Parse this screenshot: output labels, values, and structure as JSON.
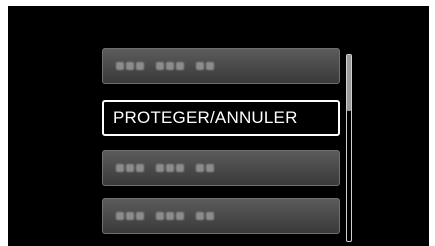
{
  "menu": {
    "items": [
      {
        "label": "",
        "blurred": true,
        "selected": false
      },
      {
        "label": "PROTEGER/ANNULER",
        "blurred": false,
        "selected": true
      },
      {
        "label": "",
        "blurred": true,
        "selected": false
      },
      {
        "label": "",
        "blurred": true,
        "selected": false
      }
    ]
  },
  "scrollbar": {
    "visible_fraction": 0.3,
    "position_fraction": 0.0
  },
  "colors": {
    "background": "#000000",
    "item_fill": "#4a4a4a",
    "selected_border": "#ffffff",
    "text": "#ffffff"
  }
}
